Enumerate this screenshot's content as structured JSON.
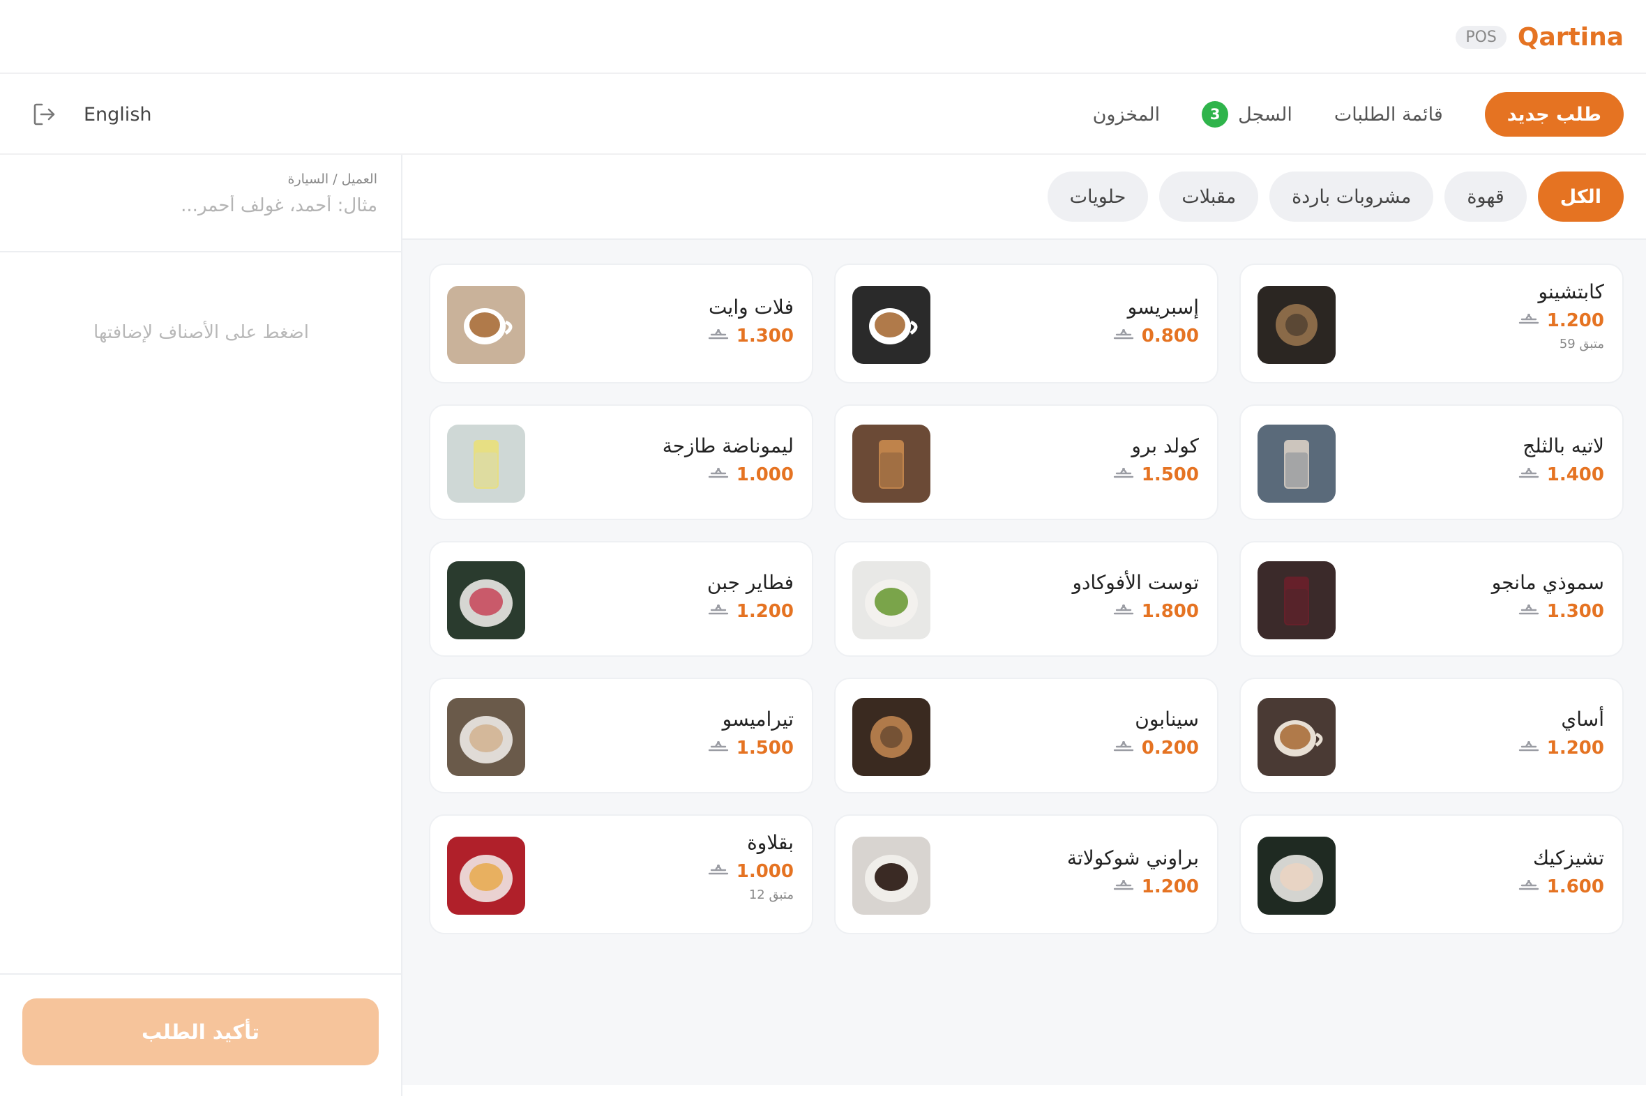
{
  "brand": {
    "name": "Qartina",
    "badge": "POS"
  },
  "nav": {
    "tabs": [
      {
        "label": "طلب جديد",
        "active": true
      },
      {
        "label": "قائمة الطلبات"
      },
      {
        "label": "السجل",
        "count": "3"
      },
      {
        "label": "المخزون"
      }
    ],
    "language": "English",
    "logout_icon": "logout-icon"
  },
  "sidebar": {
    "customer_label": "العميل / السيارة",
    "customer_placeholder": "مثال: أحمد، غولف أحمر...",
    "empty_hint": "اضغط على الأصناف لإضافتها",
    "confirm_label": "تأكيد الطلب"
  },
  "categories": [
    "الكل",
    "قهوة",
    "مشروبات باردة",
    "مقبلات",
    "حلويات"
  ],
  "colors": {
    "accent": "#e57322",
    "accent_light": "#f6c49b",
    "badge_green": "#2fb44b"
  },
  "products": [
    {
      "name": "كابتشينو",
      "price": "1.200",
      "stock": "59 متبق"
    },
    {
      "name": "إسبريسو",
      "price": "0.800"
    },
    {
      "name": "فلات وايت",
      "price": "1.300"
    },
    {
      "name": "لاتيه بالثلج",
      "price": "1.400"
    },
    {
      "name": "كولد برو",
      "price": "1.500"
    },
    {
      "name": "ليموناضة طازجة",
      "price": "1.000"
    },
    {
      "name": "سموذي مانجو",
      "price": "1.300"
    },
    {
      "name": "توست الأفوكادو",
      "price": "1.800"
    },
    {
      "name": "فطاير جبن",
      "price": "1.200"
    },
    {
      "name": "أساي",
      "price": "1.200"
    },
    {
      "name": "سينابون",
      "price": "0.200"
    },
    {
      "name": "تيراميسو",
      "price": "1.500"
    },
    {
      "name": "تشيزكيك",
      "price": "1.600"
    },
    {
      "name": "براوني شوكولاتة",
      "price": "1.200"
    },
    {
      "name": "بقلاوة",
      "price": "1.000",
      "stock": "12 متبق"
    }
  ]
}
